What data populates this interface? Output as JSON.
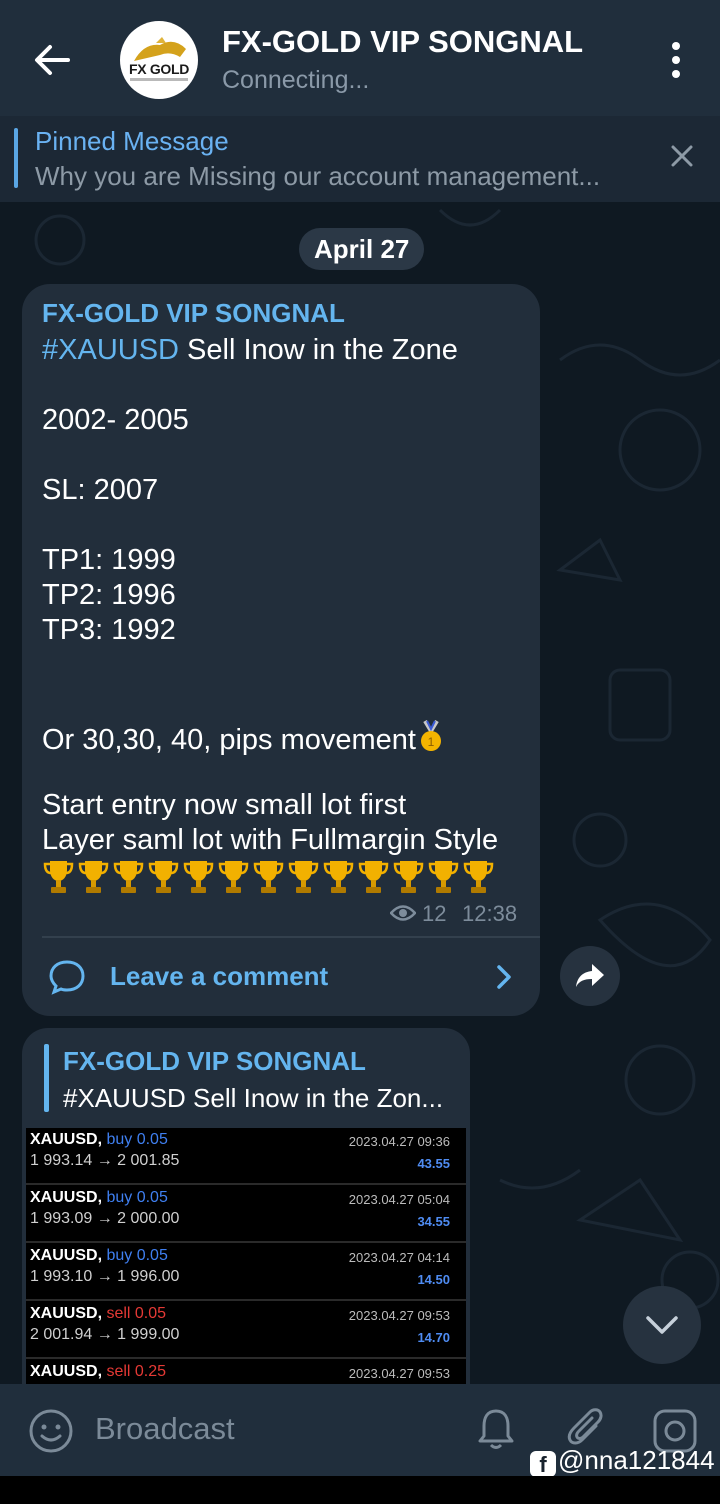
{
  "header": {
    "avatar_text": "FX GOLD",
    "title": "FX-GOLD VIP SONGNAL",
    "status": "Connecting..."
  },
  "pinned": {
    "title": "Pinned Message",
    "text": "Why you are Missing our account management..."
  },
  "chat": {
    "date": "April 27",
    "message": {
      "sender": "FX-GOLD VIP SONGNAL",
      "hashtag": "#XAUUSD",
      "headline": " Sell Inow in the Zone",
      "range": "2002- 2005",
      "sl": "SL: 2007",
      "tp1": "TP1: 1999",
      "tp2": "TP2: 1996",
      "tp3": "TP3: 1992",
      "pips": "Or 30,30, 40, pips movement",
      "entry1": "Start entry now small lot first",
      "entry2": "Layer saml lot with Fullmargin Style",
      "trophy_count": 13,
      "views": "12",
      "time": "12:38",
      "comment_label": "Leave a comment"
    },
    "reply": {
      "sender": "FX-GOLD VIP SONGNAL",
      "text": "#XAUUSD Sell Inow in the Zon...",
      "trades": [
        {
          "symbol": "XAUUSD,",
          "side": "buy 0.05",
          "side_color": "#3f7ff0",
          "prices": "1 993.14 → 2 001.85",
          "date": "2023.04.27 09:36",
          "profit": "43.55"
        },
        {
          "symbol": "XAUUSD,",
          "side": "buy 0.05",
          "side_color": "#3f7ff0",
          "prices": "1 993.09 → 2 000.00",
          "date": "2023.04.27 05:04",
          "profit": "34.55"
        },
        {
          "symbol": "XAUUSD,",
          "side": "buy 0.05",
          "side_color": "#3f7ff0",
          "prices": "1 993.10 → 1 996.00",
          "date": "2023.04.27 04:14",
          "profit": "14.50"
        },
        {
          "symbol": "XAUUSD,",
          "side": "sell 0.05",
          "side_color": "#e53935",
          "prices": "2 001.94 → 1 999.00",
          "date": "2023.04.27 09:53",
          "profit": "14.70"
        },
        {
          "symbol": "XAUUSD,",
          "side": "sell 0.25",
          "side_color": "#e53935",
          "prices": "",
          "date": "2023.04.27 09:53",
          "profit": ""
        }
      ]
    }
  },
  "bottom": {
    "placeholder": "Broadcast",
    "watermark": "@nna121844"
  },
  "colors": {
    "accent": "#64b5ef",
    "header_bg": "#202e3c",
    "bubble_bg": "#222e3b",
    "profit": "#4f8cf2"
  },
  "icons": [
    "back-arrow-icon",
    "more-vertical-icon",
    "close-icon",
    "eye-icon",
    "comment-icon",
    "chevron-right-icon",
    "share-icon",
    "chevron-down-icon",
    "emoji-icon",
    "bell-icon",
    "attach-icon",
    "camera-icon",
    "trophy-icon",
    "medal-icon",
    "facebook-icon"
  ]
}
